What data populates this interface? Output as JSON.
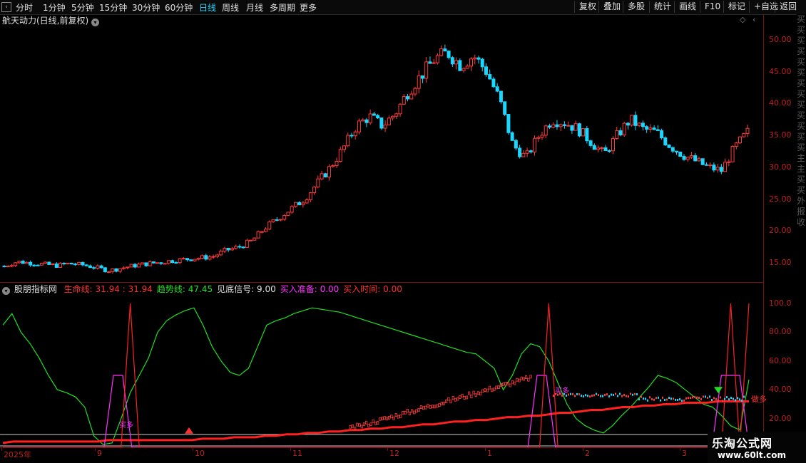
{
  "toolbar": {
    "left": [
      "分时",
      "1分钟",
      "5分钟",
      "15分钟",
      "30分钟",
      "60分钟",
      "日线",
      "周线",
      "月线",
      "多周期",
      "更多"
    ],
    "active_index": 6,
    "right": [
      "复权",
      "叠加",
      "多股",
      "统计",
      "画线",
      "F10",
      "标记",
      "+自选",
      "返回"
    ]
  },
  "stock": {
    "title": "航天动力(日线,前复权)"
  },
  "price_axis": [
    "50.00",
    "45.00",
    "40.00",
    "35.00",
    "30.00",
    "25.00",
    "20.00",
    "15.00"
  ],
  "indicator": {
    "name": "股朋指标网",
    "items": [
      {
        "label": "生命线: 31.94 : 31.94",
        "color": "#ff3030"
      },
      {
        "label": "趋势线: 47.45",
        "color": "#20e020"
      },
      {
        "label": "见底信号: 9.00",
        "color": "#e0e0e0"
      },
      {
        "label": "买入准备: 0.00",
        "color": "#ff30ff"
      },
      {
        "label": "买入时间: 0.00",
        "color": "#ff3030"
      }
    ]
  },
  "ind_axis": [
    "100.0",
    "80.00",
    "60.00",
    "40.00",
    "20.00"
  ],
  "annotations": {
    "buy1": "买多",
    "buy2": "买多",
    "tail": "做多"
  },
  "dates": [
    "2025年",
    "9",
    "10",
    "11",
    "12",
    "1",
    "2",
    "3"
  ],
  "watermark": {
    "name": "乐淘公式网",
    "url": "www.60lt.com"
  },
  "colors": {
    "up": "#ff3a3a",
    "down": "#19d7ff",
    "trend": "#20e020",
    "life": "#ff2020",
    "prep": "#ff30ff"
  },
  "chart_data": [
    {
      "type": "candlestick",
      "title": "航天动力(日线,前复权)",
      "ylim": [
        12,
        52
      ],
      "x_positions": [
        5,
        136,
        273,
        410,
        546,
        683,
        820,
        956,
        1050
      ],
      "x_labels": [
        "2025年",
        "9",
        "10",
        "11",
        "12",
        "1",
        "2",
        "3",
        ""
      ],
      "close": [
        14.5,
        15.2,
        15.0,
        14.8,
        14.6,
        14.9,
        14.7,
        14.3,
        13.8,
        14.2,
        14.6,
        14.9,
        15.1,
        15.4,
        15.6,
        15.8,
        16.0,
        17.0,
        17.5,
        18.5,
        20.5,
        22.0,
        23.5,
        25.0,
        27.5,
        30.0,
        33.0,
        36.5,
        38.0,
        36.5,
        38.5,
        42.0,
        44.5,
        47.0,
        48.0,
        46.0,
        47.5,
        45.0,
        40.5,
        33.5,
        31.5,
        35.0,
        37.5,
        37.0,
        36.0,
        34.0,
        32.0,
        35.0,
        37.5,
        36.0,
        35.5,
        33.5,
        32.0,
        31.0,
        30.0,
        29.5,
        33.0,
        35.5
      ],
      "series_names": [
        "K线"
      ]
    },
    {
      "type": "line",
      "title": "股朋指标网",
      "ylim": [
        0,
        105
      ],
      "series": [
        {
          "name": "趋势线",
          "values": [
            85,
            93,
            80,
            72,
            62,
            50,
            40,
            38,
            35,
            28,
            8,
            2,
            3,
            20,
            38,
            50,
            62,
            80,
            88,
            92,
            95,
            97,
            85,
            70,
            60,
            52,
            50,
            55,
            70,
            85,
            88,
            90,
            93,
            95,
            97,
            96,
            95,
            94,
            92,
            90,
            88,
            86,
            84,
            82,
            80,
            78,
            76,
            74,
            72,
            70,
            68,
            66,
            65,
            60,
            55,
            40,
            50,
            65,
            72,
            70,
            60,
            45,
            30,
            20,
            15,
            12,
            10,
            15,
            22,
            28,
            35,
            42,
            50,
            48,
            45,
            40,
            35,
            30,
            28,
            22,
            15,
            12,
            47
          ]
        },
        {
          "name": "生命线",
          "values": [
            3,
            4,
            4,
            4,
            4,
            4,
            4,
            4,
            4,
            4,
            5,
            5,
            5,
            5,
            5,
            5,
            5,
            5,
            5,
            6,
            6,
            6,
            7,
            7,
            7,
            8,
            8,
            9,
            9,
            10,
            10,
            11,
            11,
            12,
            12,
            13,
            13,
            14,
            14,
            15,
            16,
            16,
            17,
            18,
            18,
            19,
            19,
            20,
            21,
            21,
            22,
            22,
            23,
            24,
            24,
            25,
            26,
            26,
            27,
            28,
            28,
            29,
            29,
            30,
            30,
            31,
            31,
            31,
            32,
            32,
            32,
            32
          ]
        },
        {
          "name": "买入准备",
          "values": [
            0,
            0,
            0,
            0,
            0,
            0,
            0,
            0,
            0,
            0,
            0,
            0,
            50,
            50,
            0,
            0,
            0,
            0,
            0,
            0,
            0,
            0,
            0,
            0,
            0,
            0,
            0,
            0,
            0,
            0,
            0,
            0,
            0,
            0,
            0,
            0,
            0,
            0,
            0,
            0,
            0,
            0,
            0,
            0,
            0,
            0,
            0,
            0,
            0,
            0,
            0,
            0,
            0,
            0,
            0,
            0,
            0,
            0,
            50,
            50,
            0,
            0,
            0,
            0,
            0,
            0,
            0,
            0,
            0,
            0,
            0,
            0,
            0,
            0,
            0,
            0,
            0,
            0,
            50,
            50,
            50,
            0
          ]
        },
        {
          "name": "买入时间",
          "values": [
            0,
            0,
            0,
            0,
            0,
            0,
            0,
            0,
            0,
            0,
            0,
            0,
            0,
            0,
            100,
            0,
            0,
            0,
            0,
            0,
            0,
            0,
            0,
            0,
            0,
            0,
            0,
            0,
            0,
            0,
            0,
            0,
            0,
            0,
            0,
            0,
            0,
            0,
            0,
            0,
            0,
            0,
            0,
            0,
            0,
            0,
            0,
            0,
            0,
            0,
            0,
            0,
            0,
            0,
            0,
            0,
            0,
            0,
            0,
            0,
            100,
            0,
            0,
            0,
            0,
            0,
            0,
            0,
            0,
            0,
            0,
            0,
            0,
            0,
            0,
            0,
            0,
            0,
            0,
            0,
            100,
            0,
            100
          ]
        }
      ]
    }
  ]
}
